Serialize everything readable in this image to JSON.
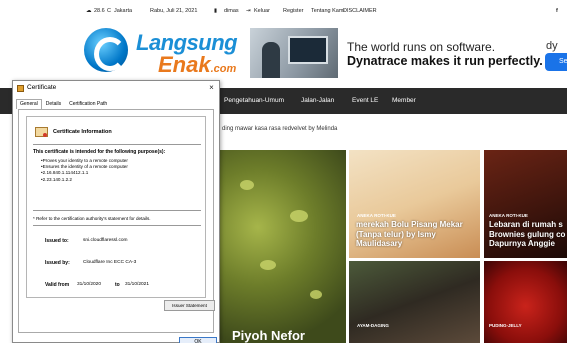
{
  "topbar": {
    "weather": "28.6",
    "weather_unit": "C",
    "city": "Jakarta",
    "date": "Rabu, Juli 21, 2021",
    "user": "dimas",
    "logout": "Keluar",
    "register": "Register",
    "about": "Tentang Kami",
    "disclaimer": "DISCLAIMER",
    "facebook": "f"
  },
  "logo": {
    "line1": "Langsung",
    "line2": "Enak",
    "line2_suffix": ".com"
  },
  "ad": {
    "line1": "The world runs on software.",
    "line2": "Dynatrace makes it run perfectly.",
    "brand": "dy",
    "cta": "Se"
  },
  "nav": [
    "Pengetahuan-Umum",
    "Jalan-Jalan",
    "Event LE",
    "Member"
  ],
  "ticker": "ding mawar kasa rasa redvelvet by Melinda",
  "tiles": {
    "big_title": "Piyoh Nefor",
    "t1_cat": "ANEKA ROTI-KUE",
    "t1_title": "merekah Bolu Pisang Mekar (Tanpa telur) by Ismy Maulidasary",
    "t2_cat": "ANEKA ROTI-KUE",
    "t2_title": "Lebaran di rumah s Brownies gulung co Dapurnya Anggie",
    "t3_cat": "AYAM-DAGING",
    "t4_cat": "PUDING-JELLY"
  },
  "dialog": {
    "title": "Certificate",
    "close": "×",
    "tabs": [
      "General",
      "Details",
      "Certification Path"
    ],
    "heading": "Certificate Information",
    "purpose_heading": "This certificate is intended for the following purpose(s):",
    "purposes": [
      "Proves your identity to a remote computer",
      "Ensures the identity of a remote computer",
      "2.16.840.1.114412.1.1",
      "2.23.140.1.2.2"
    ],
    "refer_note": "* Refer to the certification authority's statement for details.",
    "issued_to_label": "Issued to:",
    "issued_to": "sni.cloudflaressl.com",
    "issued_by_label": "Issued by:",
    "issued_by": "Cloudflare Inc ECC CA-3",
    "valid_from_label": "Valid from",
    "valid_from": "31/10/2020",
    "valid_to_label": "to",
    "valid_to": "31/10/2021",
    "issuer_statement": "Issuer Statement",
    "ok": "OK"
  }
}
